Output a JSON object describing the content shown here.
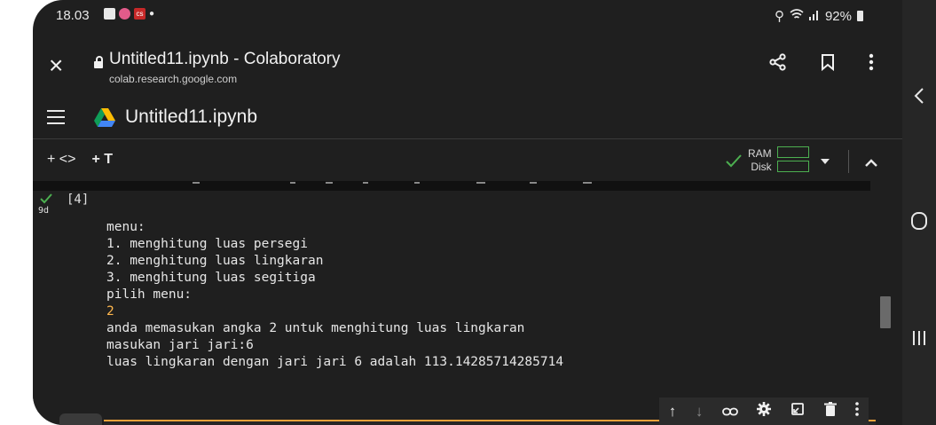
{
  "status_bar": {
    "time": "18.03",
    "battery": "92%"
  },
  "browser": {
    "page_title": "Untitled11.ipynb - Colaboratory",
    "url": "colab.research.google.com",
    "icons": [
      "close-icon",
      "lock-icon",
      "share-icon",
      "bookmark-icon",
      "more-vert-icon"
    ]
  },
  "appbar": {
    "notebook_name": "Untitled11.ipynb"
  },
  "toolbar": {
    "add_code": "+ <>",
    "add_text": "+ T",
    "ram_label": "RAM",
    "disk_label": "Disk",
    "status_color": "#4caf50"
  },
  "cell": {
    "exec_time": "9d",
    "exec_count": "[4]",
    "output_lines": [
      "menu:",
      "1. menghitung luas persegi",
      "2. menghitung luas lingkaran",
      "3. menghitung luas segitiga",
      "pilih menu:",
      "2",
      "anda memasukan angka 2 untuk menghitung luas lingkaran",
      "masukan jari jari:6",
      "luas lingkaran dengan jari jari 6 adalah 113.14285714285714"
    ]
  },
  "cell_actions": [
    "arrow-up-icon",
    "arrow-down-icon",
    "link-icon",
    "settings-icon",
    "mirror-cell-icon",
    "delete-icon",
    "more-vert-icon"
  ],
  "colors": {
    "background": "#1f1f1f",
    "accent_orange": "#f2a33a",
    "success_green": "#4caf50"
  }
}
